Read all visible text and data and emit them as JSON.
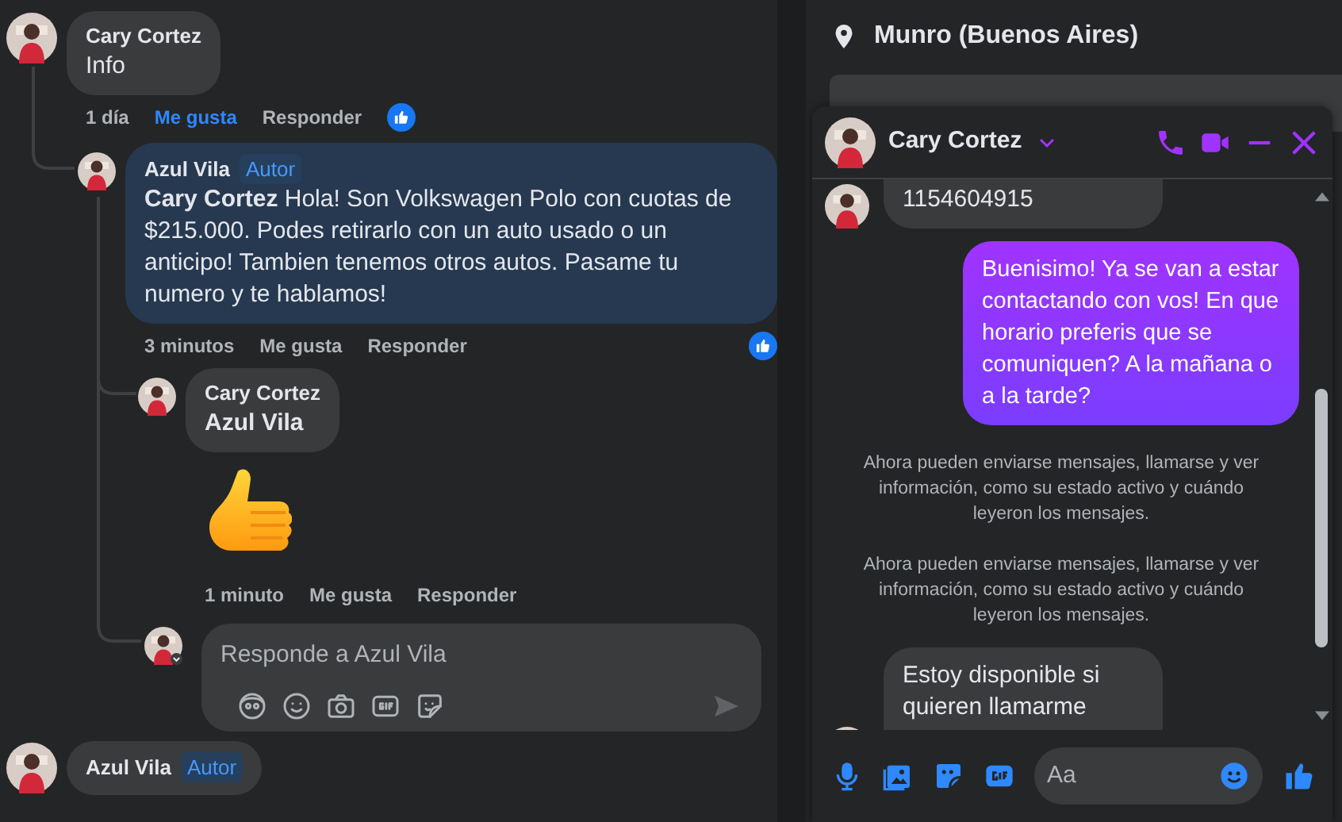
{
  "comments": [
    {
      "author": "Cary Cortez",
      "text": "Info",
      "time": "1 día",
      "like": {
        "label": "Me gusta",
        "selected": true
      },
      "reply_label": "Responder",
      "reacted": true,
      "replies": [
        {
          "author": "Azul Vila",
          "badge": "Autor",
          "mention": "Cary Cortez",
          "text": "Hola! Son Volkswagen Polo con cuotas de $215.000. Podes retirarlo con un auto usado o un anticipo! Tambien tenemos otros autos. Pasame tu numero y te hablamos!",
          "time": "3 minutos",
          "like": {
            "label": "Me gusta",
            "selected": false
          },
          "reply_label": "Responder",
          "reacted": true,
          "replies": [
            {
              "author": "Cary Cortez",
              "mention": "Azul Vila",
              "sticker": true,
              "time": "1 minuto",
              "like": {
                "label": "Me gusta",
                "selected": false
              },
              "reply_label": "Responder",
              "reacted": false
            }
          ],
          "reply_box": {
            "placeholder": "Responde a Azul Vila"
          }
        }
      ]
    },
    {
      "author": "Azul Vila",
      "badge": "Autor"
    }
  ],
  "place": "Munro (Buenos Aires)",
  "chat": {
    "name": "Cary Cortez",
    "messages": [
      {
        "kind": "received",
        "text": "1154604915"
      },
      {
        "kind": "sent",
        "text": "Buenisimo! Ya se van a estar contactando con vos! En que horario preferis que se comuniquen? A la mañana o a la tarde?"
      },
      {
        "kind": "system",
        "text": "Ahora pueden enviarse mensajes, llamarse y ver información, como su estado activo y cuándo leyeron los mensajes."
      },
      {
        "kind": "system",
        "text": "Ahora pueden enviarse mensajes, llamarse y ver información, como su estado activo y cuándo leyeron los mensajes."
      },
      {
        "kind": "received",
        "text": "Estoy disponible si quieren llamarme"
      }
    ],
    "composer": {
      "placeholder": "Aa"
    }
  }
}
